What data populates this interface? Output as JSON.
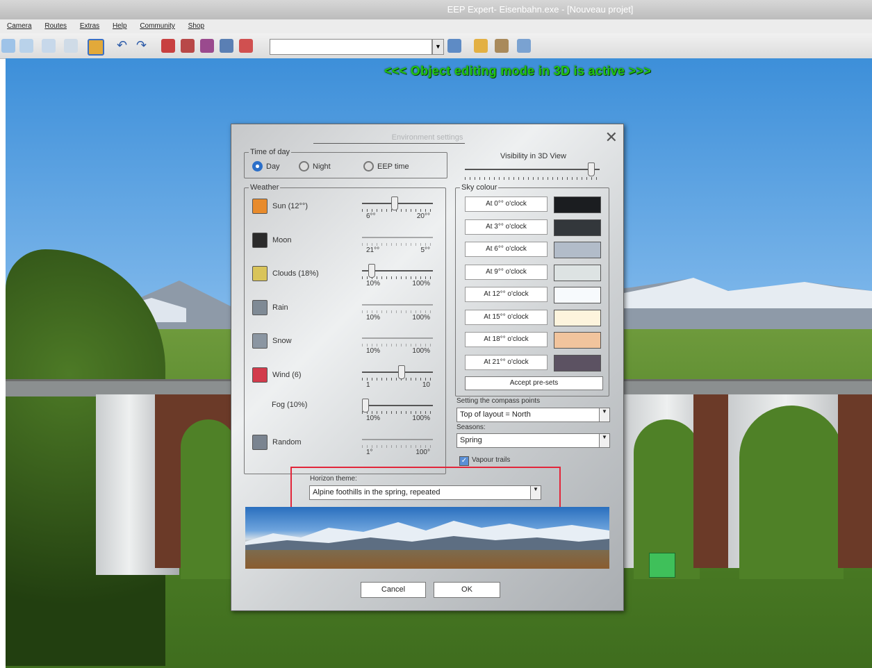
{
  "app": {
    "title": "EEP Expert- Eisenbahn.exe - [Nouveau projet]"
  },
  "menu": [
    "Camera",
    "Routes",
    "Extras",
    "Help",
    "Community",
    "Shop"
  ],
  "toolbar": {
    "combo_value": ""
  },
  "scene": {
    "banner": "<<<  Object editing mode in 3D is active  >>>"
  },
  "dialog": {
    "title": "Environment settings",
    "close": "✕",
    "time_of_day": {
      "legend": "Time of day",
      "options": [
        "Day",
        "Night",
        "EEP time"
      ],
      "selected": "Day"
    },
    "visibility": {
      "label": "Visibility in 3D View",
      "level": 0.95
    },
    "weather": {
      "legend": "Weather",
      "rows": [
        {
          "label": "Sun (12°°)",
          "icon": "sun-icon",
          "icon_color": "#e88b2c",
          "min": "6°°",
          "max": "20°°",
          "level": 0.45,
          "enabled": true
        },
        {
          "label": "Moon",
          "icon": "moon-icon",
          "icon_color": "#2b2b2b",
          "min": "21°°",
          "max": "5°°",
          "level": 0.0,
          "enabled": false
        },
        {
          "label": "Clouds (18%)",
          "icon": "clouds-icon",
          "icon_color": "#d9c45a",
          "min": "10%",
          "max": "100%",
          "level": 0.1,
          "enabled": true
        },
        {
          "label": "Rain",
          "icon": "rain-icon",
          "icon_color": "#7f8a95",
          "min": "10%",
          "max": "100%",
          "level": 0.0,
          "enabled": false
        },
        {
          "label": "Snow",
          "icon": "snow-icon",
          "icon_color": "#8b96a2",
          "min": "10%",
          "max": "100%",
          "level": 0.0,
          "enabled": false
        },
        {
          "label": "Wind (6)",
          "icon": "wind-icon",
          "icon_color": "#d23b4b",
          "min": "1",
          "max": "10",
          "level": 0.55,
          "enabled": true
        },
        {
          "label": "Fog (10%)",
          "icon": "",
          "icon_color": "",
          "min": "10%",
          "max": "100%",
          "level": 0.0,
          "enabled": true
        },
        {
          "label": "Random",
          "icon": "random-icon",
          "icon_color": "#7a8490",
          "min": "1°",
          "max": "100°",
          "level": 0.0,
          "enabled": false
        }
      ]
    },
    "sky_colour": {
      "legend": "Sky colour",
      "rows": [
        {
          "label": "At 0°° o'clock",
          "color": "#1b1d20"
        },
        {
          "label": "At 3°° o'clock",
          "color": "#33373b"
        },
        {
          "label": "At 6°° o'clock",
          "color": "#b2bcc9"
        },
        {
          "label": "At 9°° o'clock",
          "color": "#dde3e3"
        },
        {
          "label": "At 12°° o'clock",
          "color": "#f7fafd"
        },
        {
          "label": "At 15°° o'clock",
          "color": "#fdf4dd"
        },
        {
          "label": "At 18°° o'clock",
          "color": "#f1c49d"
        },
        {
          "label": "At 21°° o'clock",
          "color": "#5c5262"
        }
      ],
      "accept": "Accept pre-sets"
    },
    "compass": {
      "label": "Setting the compass points",
      "value": "Top of layout = North"
    },
    "seasons": {
      "label": "Seasons:",
      "value": "Spring"
    },
    "vapour_trails": {
      "label": "Vapour trails",
      "checked": true
    },
    "horizon": {
      "label": "Horizon theme:",
      "value": "Alpine foothills in the spring, repeated"
    },
    "cancel": "Cancel",
    "ok": "OK"
  },
  "colors": {
    "highlight": "#e2263a",
    "banner": "#21c412"
  }
}
